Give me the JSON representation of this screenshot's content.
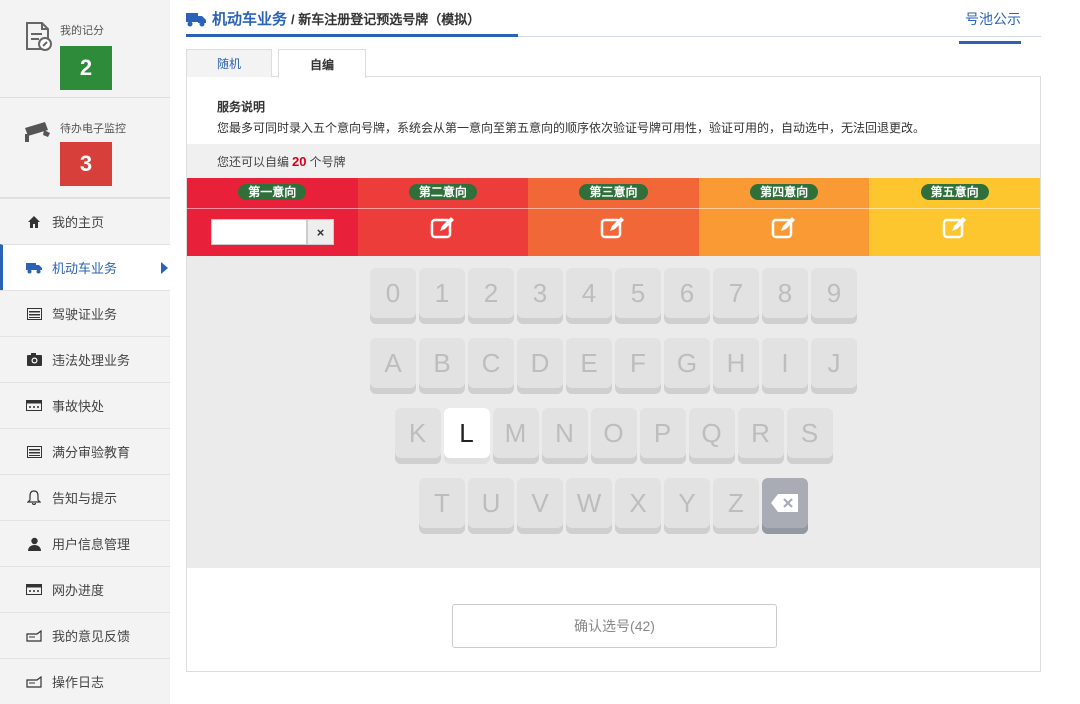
{
  "sidebar": {
    "stats": [
      {
        "label": "我的记分",
        "value": "2",
        "color": "#2e8b3a",
        "icon": "score-document-icon"
      },
      {
        "label": "待办电子监控",
        "value": "3",
        "color": "#d7403a",
        "icon": "surveillance-camera-icon"
      }
    ],
    "items": [
      {
        "label": "我的主页",
        "icon": "home-icon"
      },
      {
        "label": "机动车业务",
        "icon": "truck-icon",
        "active": true
      },
      {
        "label": "驾驶证业务",
        "icon": "license-card-icon"
      },
      {
        "label": "违法处理业务",
        "icon": "camera-icon"
      },
      {
        "label": "事故快处",
        "icon": "accident-icon"
      },
      {
        "label": "满分审验教育",
        "icon": "list-card-icon"
      },
      {
        "label": "告知与提示",
        "icon": "bell-icon"
      },
      {
        "label": "用户信息管理",
        "icon": "user-icon"
      },
      {
        "label": "网办进度",
        "icon": "progress-icon"
      },
      {
        "label": "我的意见反馈",
        "icon": "feedback-icon"
      },
      {
        "label": "操作日志",
        "icon": "log-icon"
      }
    ]
  },
  "header": {
    "section": "机动车业务",
    "page": "/ 新车注册登记预选号牌（模拟）",
    "pool_link": "号池公示"
  },
  "tabs": [
    {
      "label": "随机"
    },
    {
      "label": "自编",
      "active": true
    }
  ],
  "service": {
    "title": "服务说明",
    "text": "您最多可同时录入五个意向号牌，系统会从第一意向至第五意向的顺序依次验证号牌可用性，验证可用的，自动选中，无法回退更改。"
  },
  "remaining": {
    "prefix": "您还可以自编",
    "count": "20",
    "suffix": "个号牌"
  },
  "intents": [
    {
      "label": "第一意向",
      "color": "#e8203a"
    },
    {
      "label": "第二意向",
      "color": "#ec3d3b"
    },
    {
      "label": "第三意向",
      "color": "#f26738"
    },
    {
      "label": "第四意向",
      "color": "#f99a34"
    },
    {
      "label": "第五意向",
      "color": "#fdc62f"
    }
  ],
  "plate_input": {
    "value": "",
    "placeholder": ""
  },
  "keyboard": {
    "rows": [
      [
        "0",
        "1",
        "2",
        "3",
        "4",
        "5",
        "6",
        "7",
        "8",
        "9"
      ],
      [
        "A",
        "B",
        "C",
        "D",
        "E",
        "F",
        "G",
        "H",
        "I",
        "J"
      ],
      [
        "K",
        "L",
        "M",
        "N",
        "O",
        "P",
        "Q",
        "R",
        "S"
      ],
      [
        "T",
        "U",
        "V",
        "W",
        "X",
        "Y",
        "Z",
        "⌫"
      ]
    ],
    "active_key": "L",
    "backspace_icon": "backspace-icon"
  },
  "confirm": {
    "label": "确认选号(42)"
  }
}
